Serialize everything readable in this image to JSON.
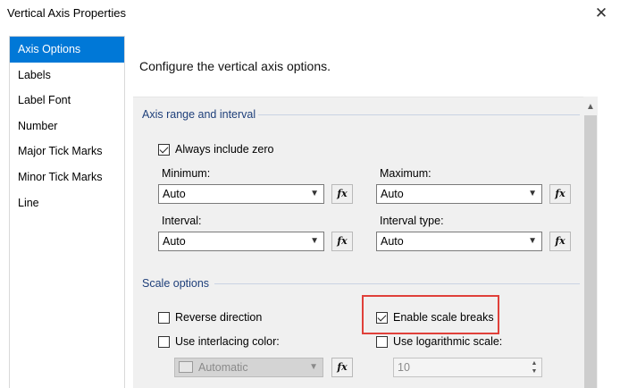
{
  "window": {
    "title": "Vertical Axis Properties",
    "close_glyph": "✕"
  },
  "sidebar": {
    "items": [
      {
        "label": "Axis Options",
        "selected": true
      },
      {
        "label": "Labels"
      },
      {
        "label": "Label Font"
      },
      {
        "label": "Number"
      },
      {
        "label": "Major Tick Marks"
      },
      {
        "label": "Minor Tick Marks"
      },
      {
        "label": "Line"
      }
    ]
  },
  "main": {
    "heading": "Configure the vertical axis options.",
    "axis_range": {
      "title": "Axis range and interval",
      "always_include_zero": {
        "label": "Always include zero",
        "checked": true
      },
      "minimum": {
        "label": "Minimum:",
        "value": "Auto"
      },
      "maximum": {
        "label": "Maximum:",
        "value": "Auto"
      },
      "interval": {
        "label": "Interval:",
        "value": "Auto"
      },
      "interval_type": {
        "label": "Interval type:",
        "value": "Auto"
      },
      "fx_label": "fx"
    },
    "scale_options": {
      "title": "Scale options",
      "reverse_direction": {
        "label": "Reverse direction",
        "checked": false
      },
      "enable_scale_breaks": {
        "label": "Enable scale breaks",
        "checked": true
      },
      "use_interlacing_color": {
        "label": "Use interlacing color:",
        "checked": false
      },
      "use_log_scale": {
        "label": "Use logarithmic scale:",
        "checked": false
      },
      "interlacing_color": {
        "value": "Automatic",
        "disabled": true
      },
      "log_base": {
        "value": "10",
        "disabled": true
      }
    }
  },
  "icons": {
    "dropdown": "chevron-down-icon",
    "expression": "function-fx-icon",
    "scroll_up": "chevron-up-icon"
  },
  "colors": {
    "selection": "#0078d7",
    "section_title": "#1e3f7a",
    "highlight": "#e0403a"
  }
}
